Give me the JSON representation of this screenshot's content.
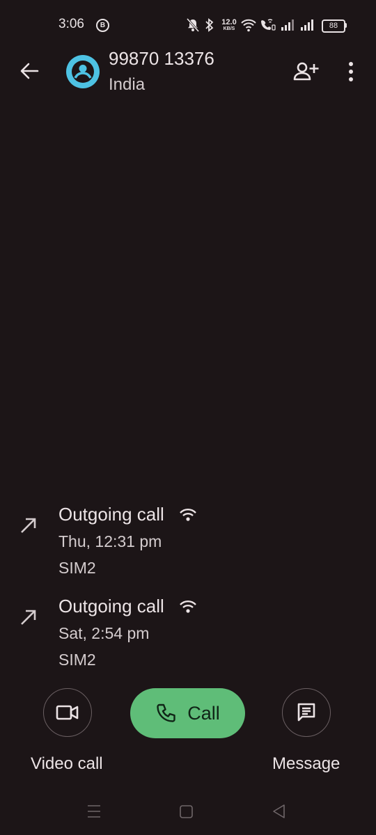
{
  "status_bar": {
    "time": "3:06",
    "notification_icon": "b-circle-icon",
    "network_speed_value": "12.0",
    "network_speed_unit": "KB/S",
    "battery": "88"
  },
  "header": {
    "number": "99870 13376",
    "country": "India"
  },
  "call_log": [
    {
      "type": "Outgoing call",
      "time": "Thu, 12:31 pm",
      "sim": "SIM2"
    },
    {
      "type": "Outgoing call",
      "time": "Sat, 2:54 pm",
      "sim": "SIM2"
    }
  ],
  "actions": {
    "video_call_label": "Video call",
    "call_label": "Call",
    "message_label": "Message"
  },
  "colors": {
    "background": "#1c1517",
    "avatar": "#4ec2e3",
    "call_button": "#5fbd78"
  }
}
